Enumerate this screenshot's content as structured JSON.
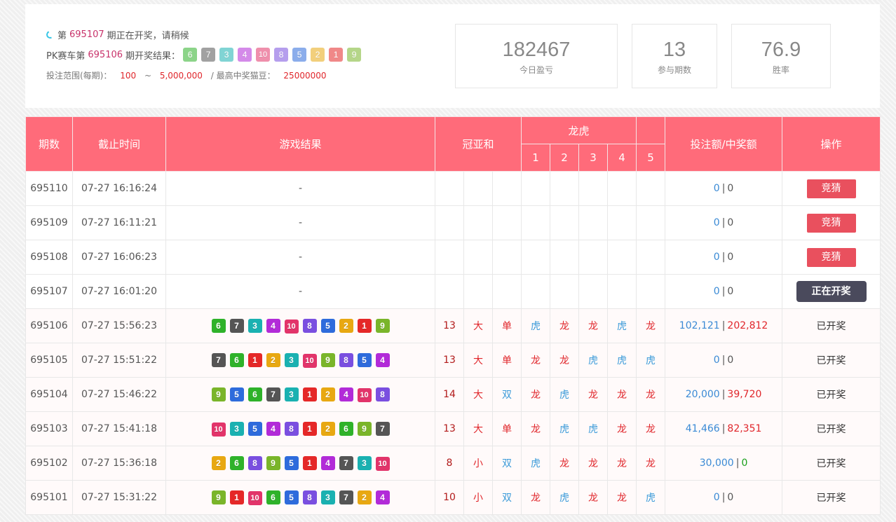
{
  "header": {
    "current_prefix": "第",
    "current_issue": "695107",
    "current_suffix": "期正在开奖，请稍候",
    "last_prefix": "PK赛车第",
    "last_issue": "695106",
    "last_suffix": "期开奖结果：",
    "last_balls": [
      6,
      7,
      3,
      4,
      10,
      8,
      5,
      2,
      1,
      9
    ],
    "range_label": "投注范围(每期)：",
    "range_min": "100",
    "range_tilde": "~",
    "range_max": "5,000,000",
    "max_label": "/ 最高中奖猫豆：",
    "max_value": "25000000"
  },
  "stats": [
    {
      "value": "182467",
      "label": "今日盈亏"
    },
    {
      "value": "13",
      "label": "参与期数"
    },
    {
      "value": "76.9",
      "label": "胜率"
    }
  ],
  "table": {
    "headers": {
      "issue": "期数",
      "deadline": "截止时间",
      "result": "游戏结果",
      "sum": "冠亚和",
      "dragon_tiger": "龙虎",
      "dt_cols": [
        "1",
        "2",
        "3",
        "4",
        "5"
      ],
      "amount": "投注额/中奖额",
      "action": "操作"
    },
    "rows": [
      {
        "issue": "695110",
        "time": "07-27 16:16:24",
        "balls": [],
        "result_placeholder": "-",
        "sum": "",
        "size": "",
        "parity": "",
        "dt": [
          "",
          "",
          "",
          "",
          ""
        ],
        "bet": "0",
        "win": "0",
        "action": "竞猜",
        "state": "open"
      },
      {
        "issue": "695109",
        "time": "07-27 16:11:21",
        "balls": [],
        "result_placeholder": "-",
        "sum": "",
        "size": "",
        "parity": "",
        "dt": [
          "",
          "",
          "",
          "",
          ""
        ],
        "bet": "0",
        "win": "0",
        "action": "竞猜",
        "state": "open"
      },
      {
        "issue": "695108",
        "time": "07-27 16:06:23",
        "balls": [],
        "result_placeholder": "-",
        "sum": "",
        "size": "",
        "parity": "",
        "dt": [
          "",
          "",
          "",
          "",
          ""
        ],
        "bet": "0",
        "win": "0",
        "action": "竞猜",
        "state": "open"
      },
      {
        "issue": "695107",
        "time": "07-27 16:01:20",
        "balls": [],
        "result_placeholder": "-",
        "sum": "",
        "size": "",
        "parity": "",
        "dt": [
          "",
          "",
          "",
          "",
          ""
        ],
        "bet": "0",
        "win": "0",
        "action": "正在开奖",
        "state": "drawing"
      },
      {
        "issue": "695106",
        "time": "07-27 15:56:23",
        "balls": [
          6,
          7,
          3,
          4,
          10,
          8,
          5,
          2,
          1,
          9
        ],
        "sum": "13",
        "size": "大",
        "parity": "单",
        "dt": [
          "虎",
          "龙",
          "龙",
          "虎",
          "龙"
        ],
        "bet": "102,121",
        "win": "202,812",
        "action": "已开奖",
        "state": "done"
      },
      {
        "issue": "695105",
        "time": "07-27 15:51:22",
        "balls": [
          7,
          6,
          1,
          2,
          3,
          10,
          9,
          8,
          5,
          4
        ],
        "sum": "13",
        "size": "大",
        "parity": "单",
        "dt": [
          "龙",
          "龙",
          "虎",
          "虎",
          "虎"
        ],
        "bet": "0",
        "win": "0",
        "action": "已开奖",
        "state": "done"
      },
      {
        "issue": "695104",
        "time": "07-27 15:46:22",
        "balls": [
          9,
          5,
          6,
          7,
          3,
          1,
          2,
          4,
          10,
          8
        ],
        "sum": "14",
        "size": "大",
        "parity": "双",
        "dt": [
          "龙",
          "虎",
          "龙",
          "龙",
          "龙"
        ],
        "bet": "20,000",
        "win": "39,720",
        "action": "已开奖",
        "state": "done"
      },
      {
        "issue": "695103",
        "time": "07-27 15:41:18",
        "balls": [
          10,
          3,
          5,
          4,
          8,
          1,
          2,
          6,
          9,
          7
        ],
        "sum": "13",
        "size": "大",
        "parity": "单",
        "dt": [
          "龙",
          "虎",
          "虎",
          "龙",
          "龙"
        ],
        "bet": "41,466",
        "win": "82,351",
        "action": "已开奖",
        "state": "done"
      },
      {
        "issue": "695102",
        "time": "07-27 15:36:18",
        "balls": [
          2,
          6,
          8,
          9,
          5,
          1,
          4,
          7,
          3,
          10
        ],
        "sum": "8",
        "size": "小",
        "parity": "双",
        "dt": [
          "虎",
          "龙",
          "龙",
          "龙",
          "龙"
        ],
        "bet": "30,000",
        "win": "0",
        "action": "已开奖",
        "state": "done",
        "win_color": "green"
      },
      {
        "issue": "695101",
        "time": "07-27 15:31:22",
        "balls": [
          9,
          1,
          10,
          6,
          5,
          8,
          3,
          7,
          2,
          4
        ],
        "sum": "10",
        "size": "小",
        "parity": "双",
        "dt": [
          "龙",
          "虎",
          "龙",
          "龙",
          "虎"
        ],
        "bet": "0",
        "win": "0",
        "action": "已开奖",
        "state": "done"
      }
    ]
  }
}
